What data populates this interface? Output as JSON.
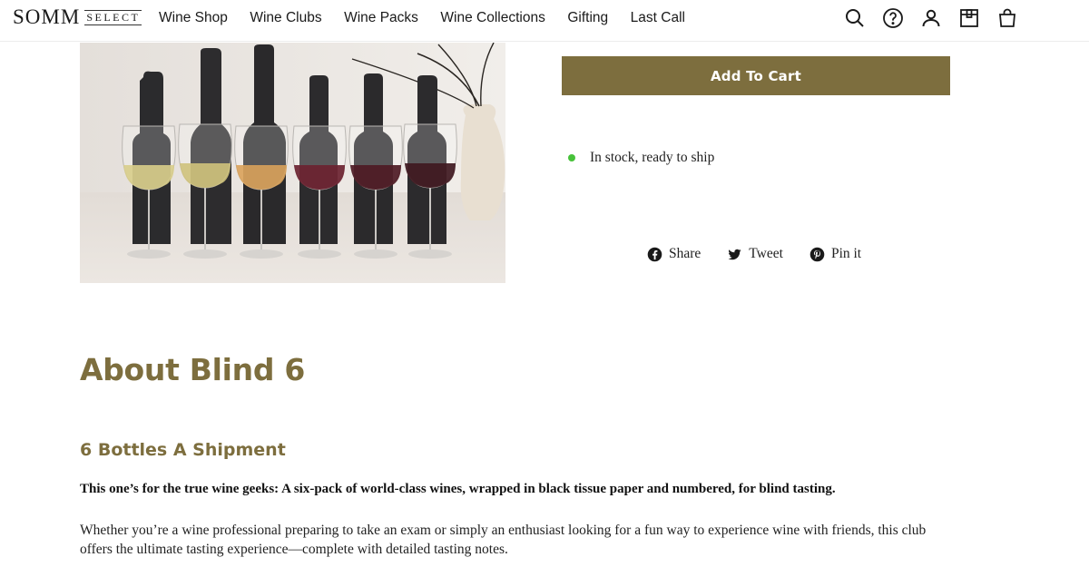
{
  "header": {
    "logo_main": "SOMM",
    "logo_sub": "SELECT",
    "nav": [
      "Wine Shop",
      "Wine Clubs",
      "Wine Packs",
      "Wine Collections",
      "Gifting",
      "Last Call"
    ],
    "icons": [
      "search-icon",
      "help-icon",
      "account-icon",
      "gift-box-icon",
      "cart-bag-icon"
    ]
  },
  "product": {
    "image_alt": "Six wrapped wine bottles with glasses of wine",
    "add_to_cart_label": "Add To Cart",
    "stock_text": "In stock, ready to ship",
    "stock_color": "#47c23a",
    "share": {
      "share_label": "Share",
      "tweet_label": "Tweet",
      "pin_label": "Pin it"
    }
  },
  "about": {
    "title": "About Blind 6",
    "subtitle": "6 Bottles A Shipment",
    "lead": "This one’s for the true wine geeks: A six-pack of world-class wines, wrapped in black tissue paper and numbered, for blind tasting.",
    "body": "Whether you’re a wine professional preparing to take an exam or simply an enthusiast looking for a fun way to experience wine with friends, this club offers the ultimate tasting experience—complete with detailed tasting notes."
  },
  "colors": {
    "accent": "#7d6e3e",
    "text": "#1a1a1a"
  }
}
